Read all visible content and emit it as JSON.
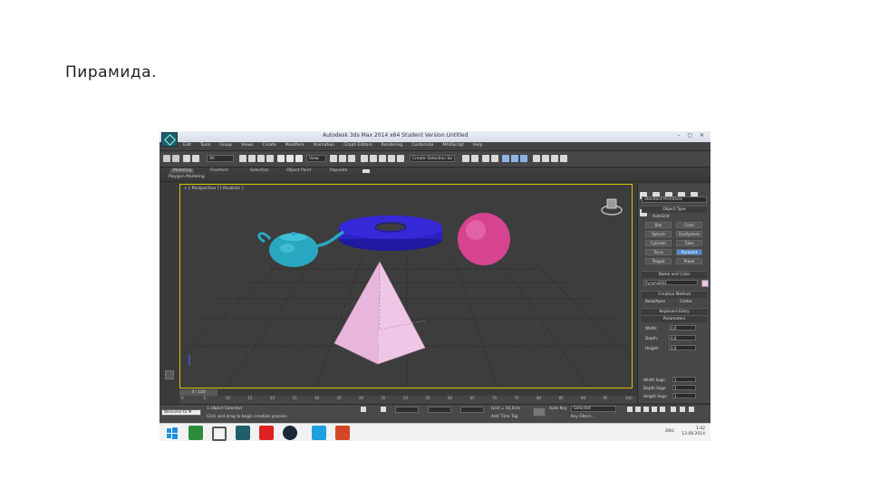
{
  "slide": {
    "title": "Пирамида."
  },
  "app": {
    "window_title": "Autodesk 3ds Max 2014 x64    Student Version    Untitled",
    "window_controls": "–  ▢  ✕",
    "menus": [
      "Edit",
      "Tools",
      "Group",
      "Views",
      "Create",
      "Modifiers",
      "Animation",
      "Graph Editors",
      "Rendering",
      "Customize",
      "MAXScript",
      "Help"
    ],
    "toolbar": {
      "filter_value": "All",
      "view_value": "View",
      "named_selection": "Create Selection Se"
    },
    "ribbon_tabs": [
      "Modeling",
      "Freeform",
      "Selection",
      "Object Paint",
      "Populate"
    ],
    "ribbon_sub": "Polygon Modeling",
    "viewport_label": "+ [ Perspective ] [ Realistic ]",
    "timeline": {
      "position": "0 / 100"
    },
    "ruler_ticks": [
      "0",
      "5",
      "10",
      "15",
      "20",
      "25",
      "30",
      "35",
      "40",
      "45",
      "50",
      "55",
      "60",
      "65",
      "70",
      "75",
      "80",
      "85",
      "90",
      "95",
      "100"
    ],
    "command_panel": {
      "category": "Standard Primitives",
      "object_type_header": "Object Type",
      "autogrid_label": "AutoGrid",
      "buttons": [
        "Box",
        "Cone",
        "Sphere",
        "GeoSphere",
        "Cylinder",
        "Tube",
        "Torus",
        "Pyramid",
        "Teapot",
        "Plane"
      ],
      "active_button": "Pyramid",
      "name_color_header": "Name and Color",
      "object_name": "Pyramid001",
      "creation_method_header": "Creation Method",
      "creation_methods": [
        "Base/Apex",
        "Center"
      ],
      "keyboard_entry_header": "Keyboard Entry",
      "parameters_header": "Parameters",
      "params": [
        {
          "label": "Width:",
          "value": "0,0"
        },
        {
          "label": "Depth:",
          "value": "0,0"
        },
        {
          "label": "Height:",
          "value": "0,0"
        }
      ],
      "segs": [
        {
          "label": "Width Segs:",
          "value": "1"
        },
        {
          "label": "Depth Segs:",
          "value": "1"
        },
        {
          "label": "Height Segs:",
          "value": "1"
        }
      ]
    },
    "status": {
      "script_field": "Welcome to M",
      "selection": "1 Object Selected",
      "prompt": "Click and drag to begin creation process",
      "grid": "Grid = 10,0cm",
      "auto_key": "Auto Key",
      "set_key_value": "Selected",
      "add_time_tag": "Add Time Tag",
      "key_filters": "Key Filters..."
    },
    "taskbar": {
      "lang": "ENG",
      "time": "1:42",
      "date": "12.08.2014"
    }
  },
  "colors": {
    "teapot": "#2aa7c0",
    "torus": "#2b22c4",
    "sphere": "#d6438f",
    "pyramid": "#f0c6e6",
    "viewport_border": "#d7c500"
  }
}
